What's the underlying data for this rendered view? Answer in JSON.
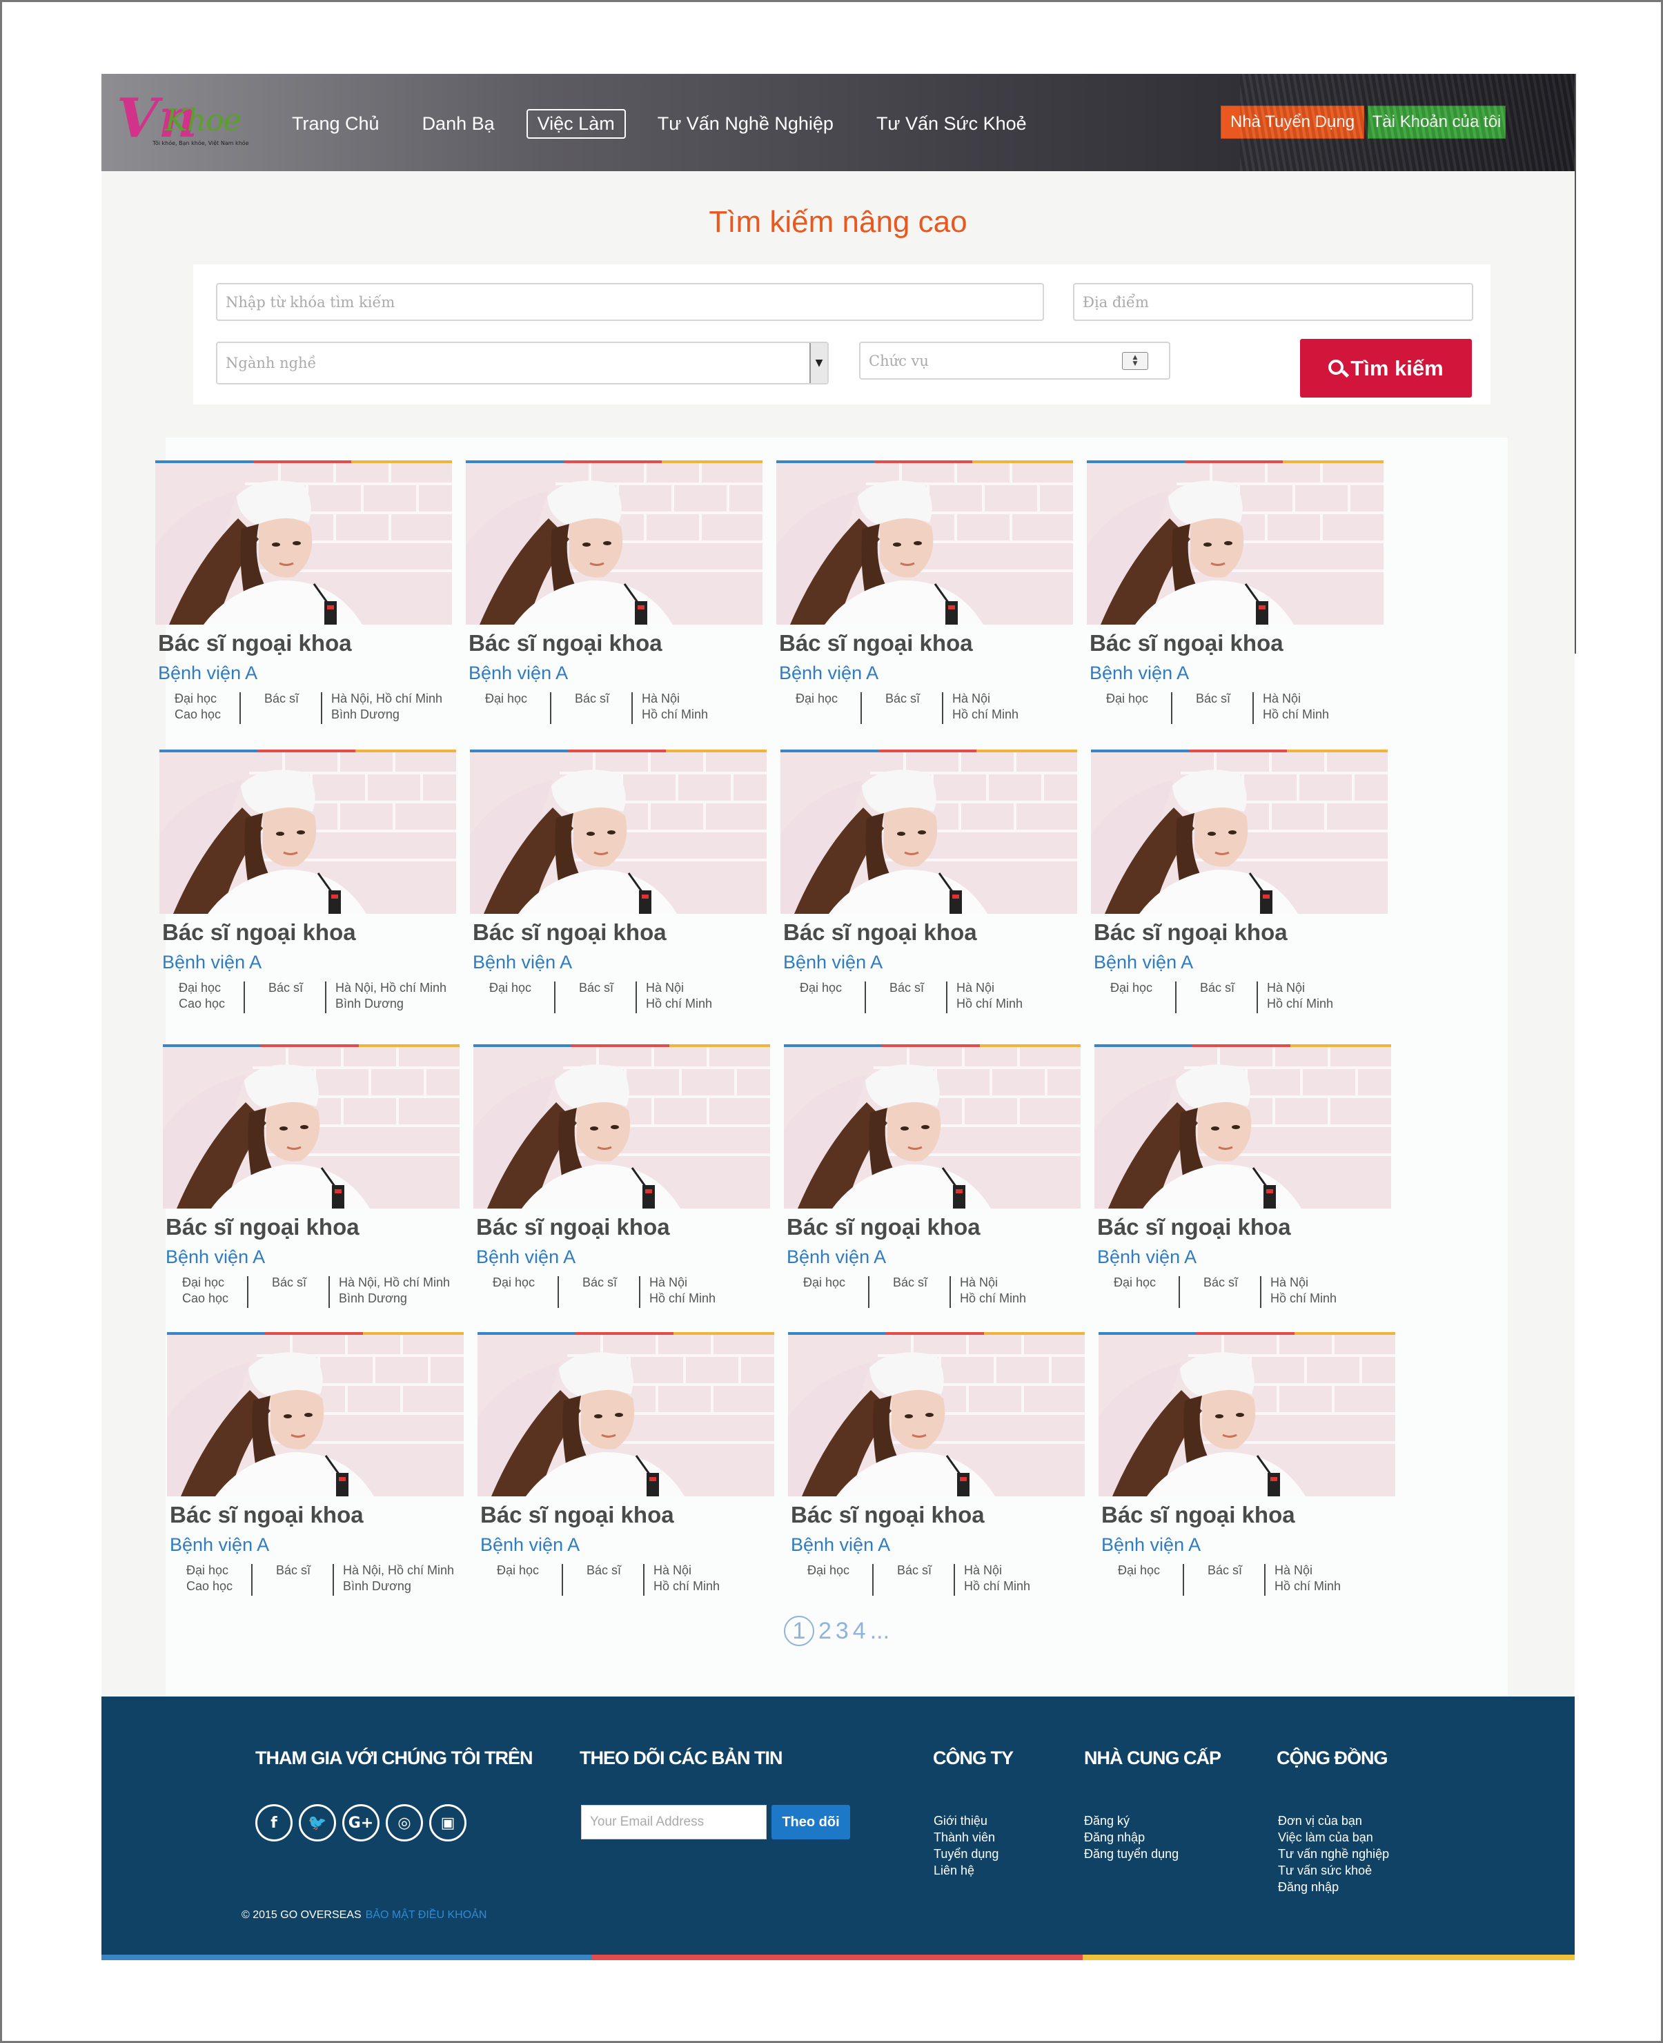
{
  "header": {
    "logo_main": "Vn",
    "logo_sub": "Khoe",
    "logo_tagline": "Tôi khỏe, Bạn khỏe, Việt Nam khỏe",
    "nav": [
      "Trang Chủ",
      "Danh Bạ",
      "Việc Làm",
      "Tư Vấn Nghề Nghiệp",
      "Tư Vấn Sức Khoẻ"
    ],
    "active_nav": "Việc Làm",
    "employer_button": "Nhà Tuyển Dụng",
    "account_button": "Tài Khoản của tôi"
  },
  "search": {
    "title": "Tìm kiếm nâng cao",
    "keyword_placeholder": "Nhập từ khóa tìm kiếm",
    "location_placeholder": "Địa điểm",
    "industry_placeholder": "Ngành nghề",
    "position_placeholder": "Chức vụ",
    "button_label": "Tìm kiếm"
  },
  "jobs": [
    {
      "title": "Bác sĩ ngoại khoa",
      "hospital": "Bệnh viện A",
      "education": "Đại học\nCao học",
      "position": "Bác sĩ",
      "location": "Hà Nội, Hồ chí Minh\nBình Dương"
    },
    {
      "title": "Bác sĩ ngoại khoa",
      "hospital": "Bệnh viện A",
      "education": "Đại học",
      "position": "Bác sĩ",
      "location": "Hà Nội\nHồ chí Minh"
    },
    {
      "title": "Bác sĩ ngoại khoa",
      "hospital": "Bệnh viện A",
      "education": "Đại học",
      "position": "Bác sĩ",
      "location": "Hà Nội\nHồ chí Minh"
    },
    {
      "title": "Bác sĩ ngoại khoa",
      "hospital": "Bệnh viện A",
      "education": "Đại học",
      "position": "Bác sĩ",
      "location": "Hà Nội\nHồ chí Minh"
    },
    {
      "title": "Bác sĩ ngoại khoa",
      "hospital": "Bệnh viện A",
      "education": "Đại học\nCao học",
      "position": "Bác sĩ",
      "location": "Hà Nội, Hồ chí Minh\nBình Dương"
    },
    {
      "title": "Bác sĩ ngoại khoa",
      "hospital": "Bệnh viện A",
      "education": "Đại học",
      "position": "Bác sĩ",
      "location": "Hà Nội\nHồ chí Minh"
    },
    {
      "title": "Bác sĩ ngoại khoa",
      "hospital": "Bệnh viện A",
      "education": "Đại học",
      "position": "Bác sĩ",
      "location": "Hà Nội\nHồ chí Minh"
    },
    {
      "title": "Bác sĩ ngoại khoa",
      "hospital": "Bệnh viện A",
      "education": "Đại học",
      "position": "Bác sĩ",
      "location": "Hà Nội\nHồ chí Minh"
    },
    {
      "title": "Bác sĩ ngoại khoa",
      "hospital": "Bệnh viện A",
      "education": "Đại học\nCao học",
      "position": "Bác sĩ",
      "location": "Hà Nội, Hồ chí Minh\nBình Dương"
    },
    {
      "title": "Bác sĩ ngoại khoa",
      "hospital": "Bệnh viện A",
      "education": "Đại học",
      "position": "Bác sĩ",
      "location": "Hà Nội\nHồ chí Minh"
    },
    {
      "title": "Bác sĩ ngoại khoa",
      "hospital": "Bệnh viện A",
      "education": "Đại học",
      "position": "Bác sĩ",
      "location": "Hà Nội\nHồ chí Minh"
    },
    {
      "title": "Bác sĩ ngoại khoa",
      "hospital": "Bệnh viện A",
      "education": "Đại học",
      "position": "Bác sĩ",
      "location": "Hà Nội\nHồ chí Minh"
    },
    {
      "title": "Bác sĩ ngoại khoa",
      "hospital": "Bệnh viện A",
      "education": "Đại học\nCao học",
      "position": "Bác sĩ",
      "location": "Hà Nội, Hồ chí Minh\nBình Dương"
    },
    {
      "title": "Bác sĩ ngoại khoa",
      "hospital": "Bệnh viện A",
      "education": "Đại học",
      "position": "Bác sĩ",
      "location": "Hà Nội\nHồ chí Minh"
    },
    {
      "title": "Bác sĩ ngoại khoa",
      "hospital": "Bệnh viện A",
      "education": "Đại học",
      "position": "Bác sĩ",
      "location": "Hà Nội\nHồ chí Minh"
    },
    {
      "title": "Bác sĩ ngoại khoa",
      "hospital": "Bệnh viện A",
      "education": "Đại học",
      "position": "Bác sĩ",
      "location": "Hà Nội\nHồ chí Minh"
    }
  ],
  "pagination": {
    "current": "1",
    "pages": [
      "2",
      "3",
      "4"
    ],
    "more": "..."
  },
  "footer": {
    "join_title": "THAM GIA VỚI CHÚNG TÔI TRÊN",
    "socials": [
      {
        "icon": "facebook-icon",
        "glyph": "f"
      },
      {
        "icon": "twitter-icon",
        "glyph": "🐦"
      },
      {
        "icon": "google-plus-icon",
        "glyph": "G+"
      },
      {
        "icon": "instagram-icon",
        "glyph": "◎"
      },
      {
        "icon": "youtube-icon",
        "glyph": "▣"
      }
    ],
    "newsletter_title": "THEO DÕI CÁC BẢN TIN",
    "email_placeholder": "Your Email Address",
    "subscribe_label": "Theo dõi",
    "company_title": "CÔNG TY",
    "company_links": [
      "Giới thiệu",
      "Thành viên",
      "Tuyển dụng",
      "Liên hệ"
    ],
    "provider_title": "NHÀ CUNG CẤP",
    "provider_links": [
      "Đăng ký",
      "Đăng nhập",
      "Đăng tuyển dụng"
    ],
    "community_title": "CỘNG ĐỒNG",
    "community_links": [
      "Đơn vị của bạn",
      "Việc làm của bạn",
      "Tư vấn nghề nghiệp",
      "Tư vấn sức khoẻ",
      "Đăng nhập"
    ],
    "copyright": "© 2015 GO OVERSEAS",
    "terms_link": "BẢO MẬT ĐIỀU KHOẢN"
  }
}
